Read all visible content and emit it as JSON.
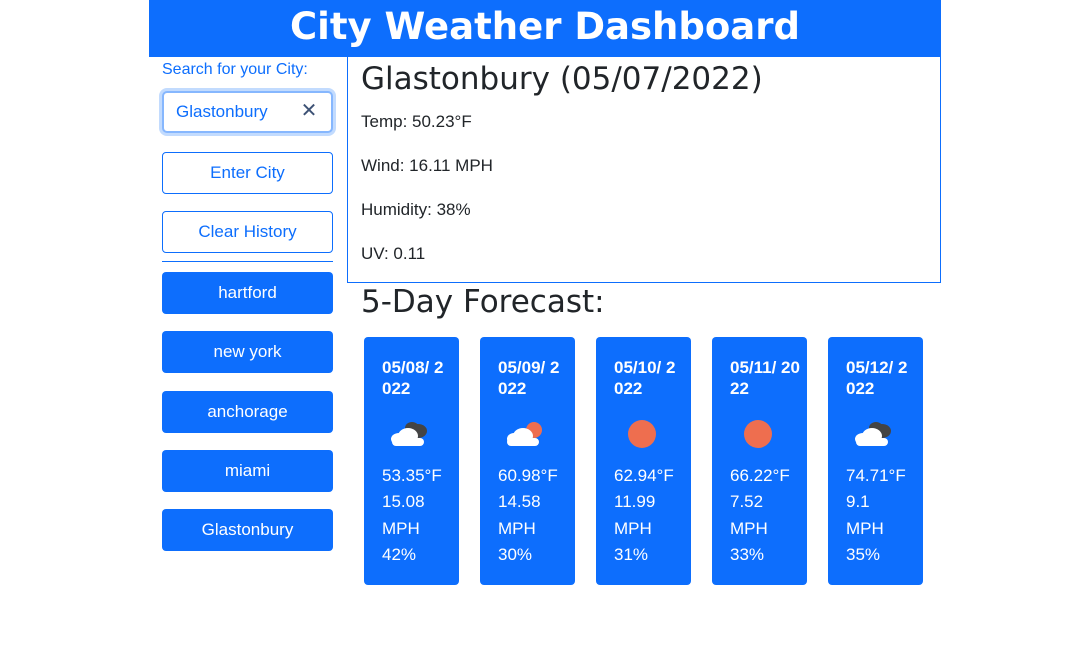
{
  "header": {
    "title": "City Weather Dashboard"
  },
  "sidebar": {
    "search_label": "Search for your City:",
    "search_value": "Glastonbury",
    "enter_label": "Enter City",
    "clear_label": "Clear History",
    "history": [
      "hartford",
      "new york",
      "anchorage",
      "miami",
      "Glastonbury"
    ]
  },
  "current": {
    "title": "Glastonbury (05/07/2022)",
    "temp": "Temp: 50.23°F",
    "wind": "Wind: 16.11 MPH",
    "humidity": "Humidity: 38%",
    "uv": "UV: 0.11"
  },
  "forecast": {
    "title": "5-Day Forecast:",
    "days": [
      {
        "date": "05/08/ 2022",
        "icon": "broken-clouds-icon",
        "temp": "53.35°F",
        "wind_value": "15.08",
        "wind_unit": "MPH",
        "humidity": "42%"
      },
      {
        "date": "05/09/ 2022",
        "icon": "few-clouds-icon",
        "temp": "60.98°F",
        "wind_value": "14.58",
        "wind_unit": "MPH",
        "humidity": "30%"
      },
      {
        "date": "05/10/ 2022",
        "icon": "clear-sky-icon",
        "temp": "62.94°F",
        "wind_value": "11.99",
        "wind_unit": "MPH",
        "humidity": "31%"
      },
      {
        "date": "05/11/ 2022",
        "icon": "clear-sky-icon",
        "temp": "66.22°F",
        "wind_value": "7.52",
        "wind_unit": "MPH",
        "humidity": "33%"
      },
      {
        "date": "05/12/ 2022",
        "icon": "broken-clouds-icon",
        "temp": "74.71°F",
        "wind_value": "9.1",
        "wind_unit": "MPH",
        "humidity": "35%"
      }
    ]
  },
  "colors": {
    "primary": "#0d6efd",
    "sun": "#ee6e4f",
    "cloud_white": "#ffffff",
    "cloud_gray": "#444444"
  }
}
